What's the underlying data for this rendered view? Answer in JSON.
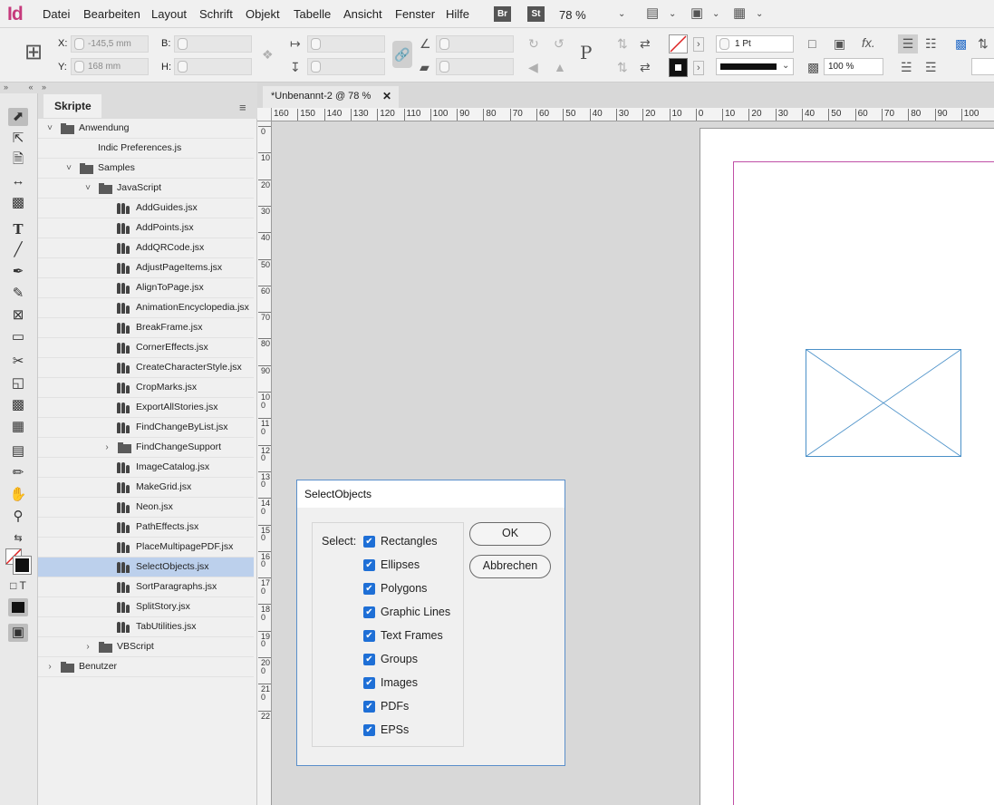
{
  "app": {
    "logo": "Id"
  },
  "menu": [
    "Datei",
    "Bearbeiten",
    "Layout",
    "Schrift",
    "Objekt",
    "Tabelle",
    "Ansicht",
    "Fenster",
    "Hilfe"
  ],
  "badges": {
    "bridge": "Br",
    "stock": "St"
  },
  "zoom": "78 %",
  "control": {
    "x_label": "X:",
    "x_value": "-145,5 mm",
    "y_label": "Y:",
    "y_value": "168 mm",
    "w_label": "B:",
    "h_label": "H:",
    "stroke_weight": "1 Pt",
    "opacity": "100 %"
  },
  "panel": {
    "tab": "Skripte",
    "items": [
      {
        "label": "Anwendung",
        "kind": "folder",
        "level": 0,
        "twisty": "open"
      },
      {
        "label": "Indic Preferences.js",
        "kind": "file",
        "level": 1,
        "twisty": ""
      },
      {
        "label": "Samples",
        "kind": "folder",
        "level": 1,
        "twisty": "open"
      },
      {
        "label": "JavaScript",
        "kind": "folder",
        "level": 2,
        "twisty": "open"
      },
      {
        "label": "AddGuides.jsx",
        "kind": "script",
        "level": 3,
        "twisty": ""
      },
      {
        "label": "AddPoints.jsx",
        "kind": "script",
        "level": 3,
        "twisty": ""
      },
      {
        "label": "AddQRCode.jsx",
        "kind": "script",
        "level": 3,
        "twisty": ""
      },
      {
        "label": "AdjustPageItems.jsx",
        "kind": "script",
        "level": 3,
        "twisty": ""
      },
      {
        "label": "AlignToPage.jsx",
        "kind": "script",
        "level": 3,
        "twisty": ""
      },
      {
        "label": "AnimationEncyclopedia.jsx",
        "kind": "script",
        "level": 3,
        "twisty": ""
      },
      {
        "label": "BreakFrame.jsx",
        "kind": "script",
        "level": 3,
        "twisty": ""
      },
      {
        "label": "CornerEffects.jsx",
        "kind": "script",
        "level": 3,
        "twisty": ""
      },
      {
        "label": "CreateCharacterStyle.jsx",
        "kind": "script",
        "level": 3,
        "twisty": ""
      },
      {
        "label": "CropMarks.jsx",
        "kind": "script",
        "level": 3,
        "twisty": ""
      },
      {
        "label": "ExportAllStories.jsx",
        "kind": "script",
        "level": 3,
        "twisty": ""
      },
      {
        "label": "FindChangeByList.jsx",
        "kind": "script",
        "level": 3,
        "twisty": ""
      },
      {
        "label": "FindChangeSupport",
        "kind": "folder",
        "level": 3,
        "twisty": "closed"
      },
      {
        "label": "ImageCatalog.jsx",
        "kind": "script",
        "level": 3,
        "twisty": ""
      },
      {
        "label": "MakeGrid.jsx",
        "kind": "script",
        "level": 3,
        "twisty": ""
      },
      {
        "label": "Neon.jsx",
        "kind": "script",
        "level": 3,
        "twisty": ""
      },
      {
        "label": "PathEffects.jsx",
        "kind": "script",
        "level": 3,
        "twisty": ""
      },
      {
        "label": "PlaceMultipagePDF.jsx",
        "kind": "script",
        "level": 3,
        "twisty": ""
      },
      {
        "label": "SelectObjects.jsx",
        "kind": "script",
        "level": 3,
        "twisty": "",
        "selected": true
      },
      {
        "label": "SortParagraphs.jsx",
        "kind": "script",
        "level": 3,
        "twisty": ""
      },
      {
        "label": "SplitStory.jsx",
        "kind": "script",
        "level": 3,
        "twisty": ""
      },
      {
        "label": "TabUtilities.jsx",
        "kind": "script",
        "level": 3,
        "twisty": ""
      },
      {
        "label": "VBScript",
        "kind": "folder",
        "level": 2,
        "twisty": "closed"
      },
      {
        "label": "Benutzer",
        "kind": "folder",
        "level": 0,
        "twisty": "closed"
      }
    ]
  },
  "document": {
    "tab_title": "*Unbenannt-2 @ 78 %",
    "close": "✕"
  },
  "ruler_top": [
    "160",
    "150",
    "140",
    "130",
    "120",
    "110",
    "100",
    "90",
    "80",
    "70",
    "60",
    "50",
    "40",
    "30",
    "20",
    "10",
    "0",
    "10",
    "20",
    "30",
    "40",
    "50",
    "60",
    "70",
    "80",
    "90",
    "100"
  ],
  "ruler_left": [
    "0",
    "10",
    "20",
    "30",
    "40",
    "50",
    "60",
    "70",
    "80",
    "90",
    "100",
    "110",
    "120",
    "130",
    "140",
    "150",
    "160",
    "170",
    "180",
    "190",
    "200",
    "210",
    "22"
  ],
  "dialog": {
    "title": "SelectObjects",
    "select_label": "Select:",
    "options": [
      "Rectangles",
      "Ellipses",
      "Polygons",
      "Graphic Lines",
      "Text Frames",
      "Groups",
      "Images",
      "PDFs",
      "EPSs"
    ],
    "ok": "OK",
    "cancel": "Abbrechen"
  },
  "colors": {
    "accent": "#1e6fd6",
    "selection": "#bcd0ec",
    "margin": "#c04fa6",
    "frame": "#4a90c8",
    "logo": "#c63a7c"
  }
}
